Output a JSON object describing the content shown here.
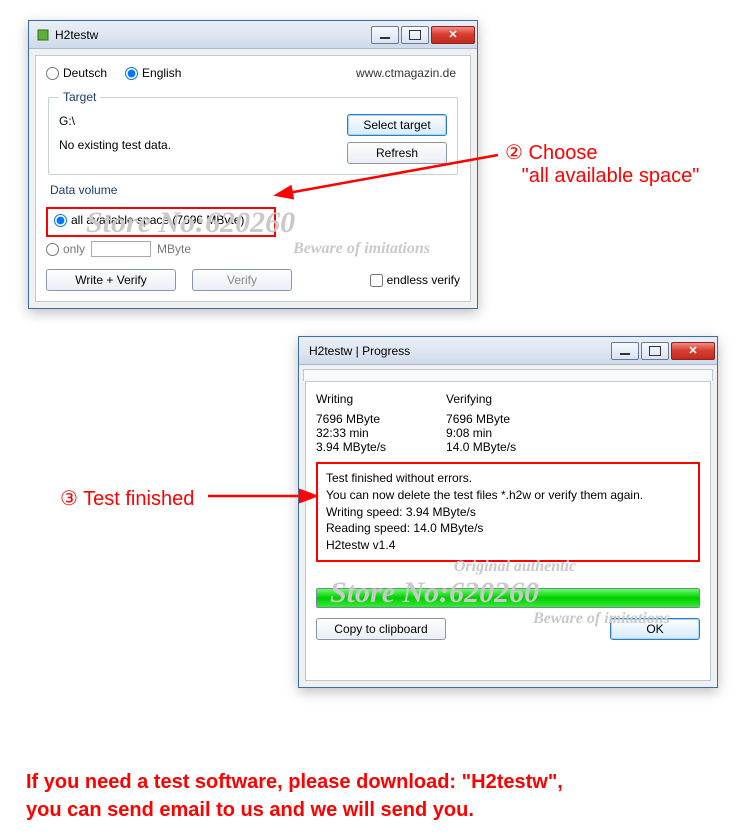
{
  "window1": {
    "title": "H2testw",
    "lang": {
      "de": "Deutsch",
      "en": "English"
    },
    "url": "www.ctmagazin.de",
    "target": {
      "legend": "Target",
      "path": "G:\\",
      "status": "No existing test data.",
      "select": "Select target",
      "refresh": "Refresh"
    },
    "volume": {
      "legend": "Data volume",
      "all": "all available space (7696 MByte)",
      "only": "only",
      "unit": "MByte"
    },
    "buttons": {
      "writeVerify": "Write + Verify",
      "verify": "Verify",
      "endless": "endless verify"
    },
    "watermark": "Store No:620260",
    "watermark_sub": "Beware of imitations"
  },
  "window2": {
    "title": "H2testw | Progress",
    "writing": {
      "label": "Writing",
      "size": "7696 MByte",
      "time": "32:33 min",
      "speed": "3.94 MByte/s"
    },
    "verifying": {
      "label": "Verifying",
      "size": "7696 MByte",
      "time": "9:08 min",
      "speed": "14.0 MByte/s"
    },
    "result": {
      "line1": "Test finished without errors.",
      "line2": "You can now delete the test files *.h2w or verify them again.",
      "line3": "Writing speed: 3.94 MByte/s",
      "line4": "Reading speed: 14.0 MByte/s",
      "line5": "H2testw v1.4"
    },
    "copy": "Copy to clipboard",
    "ok": "OK",
    "watermark": "Store No:620260",
    "watermark_sub": "Beware of imitations",
    "watermark_top": "Original authentic"
  },
  "anno2": {
    "num": "②",
    "l1": "Choose",
    "l2": "\"all available space\""
  },
  "anno3": {
    "num": "③",
    "text": "Test finished"
  },
  "footer": {
    "l1": "If you need a test software, please download: \"H2testw\",",
    "l2": "you can send email to us and we will send you."
  }
}
